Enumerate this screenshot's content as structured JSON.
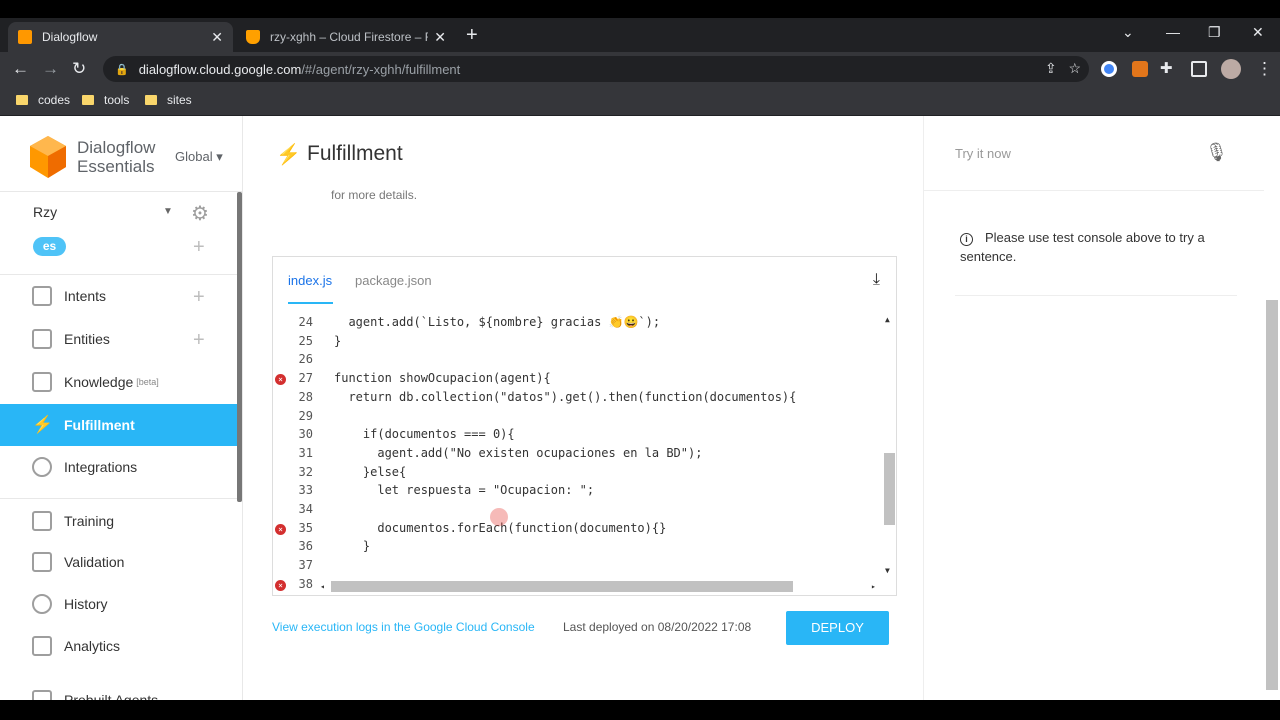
{
  "browser": {
    "tabs": [
      {
        "title": "Dialogflow",
        "close": "✕"
      },
      {
        "title": "rzy-xghh – Cloud Firestore – Fireb",
        "close": "✕"
      }
    ],
    "new_tab": "+",
    "url_host": "dialogflow.cloud.google.com",
    "url_path": "/#/agent/rzy-xghh/fulfillment",
    "bookmarks": [
      "codes",
      "tools",
      "sites"
    ],
    "window_controls": {
      "chevron": "⌄",
      "minimize": "—",
      "restore": "❐",
      "close": "✕"
    }
  },
  "sidebar": {
    "brand": "Dialogflow",
    "brand_sub": "Essentials",
    "region": "Global ▾",
    "agent_name": "Rzy",
    "language": "es",
    "items": [
      {
        "label": "Intents"
      },
      {
        "label": "Entities"
      },
      {
        "label": "Knowledge",
        "badge": "[beta]"
      },
      {
        "label": "Fulfillment"
      },
      {
        "label": "Integrations"
      },
      {
        "label": "Training"
      },
      {
        "label": "Validation"
      },
      {
        "label": "History"
      },
      {
        "label": "Analytics"
      },
      {
        "label": "Prebuilt Agents"
      }
    ],
    "active_item": "Fulfillment"
  },
  "main": {
    "title": "Fulfillment",
    "details_text": "for more details.",
    "editor_tabs": [
      "index.js",
      "package.json"
    ],
    "code_lines": [
      {
        "n": "24",
        "text": "  agent.add(`Listo, ${nombre} gracias 👏😀`);",
        "error": false
      },
      {
        "n": "25",
        "text": "}",
        "error": false
      },
      {
        "n": "26",
        "text": "",
        "error": false
      },
      {
        "n": "27",
        "text": "function showOcupacion(agent){",
        "error": true
      },
      {
        "n": "28",
        "text": "  return db.collection(\"datos\").get().then(function(documentos){",
        "error": false
      },
      {
        "n": "29",
        "text": "",
        "error": false
      },
      {
        "n": "30",
        "text": "    if(documentos === 0){",
        "error": false
      },
      {
        "n": "31",
        "text": "      agent.add(\"No existen ocupaciones en la BD\");",
        "error": false
      },
      {
        "n": "32",
        "text": "    }else{",
        "error": false
      },
      {
        "n": "33",
        "text": "      let respuesta = \"Ocupacion: \";",
        "error": false
      },
      {
        "n": "34",
        "text": "",
        "error": false
      },
      {
        "n": "35",
        "text": "      documentos.forEach(function(documento){}",
        "error": true
      },
      {
        "n": "36",
        "text": "    }",
        "error": false
      },
      {
        "n": "37",
        "text": "",
        "error": false
      },
      {
        "n": "38",
        "text": "",
        "error": true
      }
    ],
    "logs_link": "View execution logs in the Google Cloud Console",
    "last_deployed": "Last deployed on 08/20/2022 17:08",
    "deploy_label": "DEPLOY"
  },
  "right_panel": {
    "try_placeholder": "Try it now",
    "info_text": "Please use test console above to try a sentence.",
    "info_icon": "i"
  },
  "colors": {
    "accent": "#29b6f6",
    "brand_orange": "#ff9800",
    "error": "#d32f2f"
  }
}
